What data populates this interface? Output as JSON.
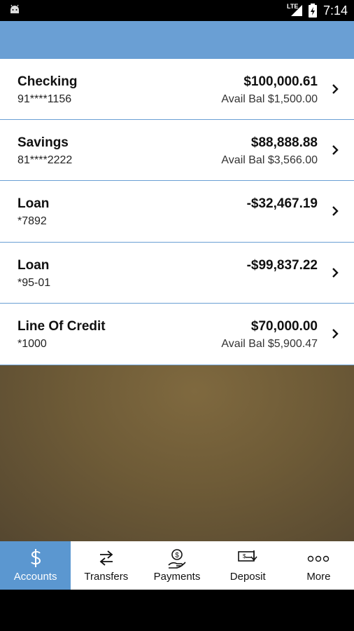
{
  "status_bar": {
    "network": "LTE",
    "time": "7:14"
  },
  "accounts": [
    {
      "name": "Checking",
      "number": "91****1156",
      "balance": "$100,000.61",
      "avail": "Avail Bal $1,500.00"
    },
    {
      "name": "Savings",
      "number": "81****2222",
      "balance": "$88,888.88",
      "avail": "Avail Bal $3,566.00"
    },
    {
      "name": "Loan",
      "number": "*7892",
      "balance": "-$32,467.19",
      "avail": ""
    },
    {
      "name": "Loan",
      "number": "*95-01",
      "balance": "-$99,837.22",
      "avail": ""
    },
    {
      "name": "Line Of Credit",
      "number": "*1000",
      "balance": "$70,000.00",
      "avail": "Avail Bal $5,900.47"
    }
  ],
  "tabs": [
    {
      "label": "Accounts",
      "icon": "dollar-icon",
      "active": true
    },
    {
      "label": "Transfers",
      "icon": "transfer-arrows-icon",
      "active": false
    },
    {
      "label": "Payments",
      "icon": "hand-coin-icon",
      "active": false
    },
    {
      "label": "Deposit",
      "icon": "check-deposit-icon",
      "active": false
    },
    {
      "label": "More",
      "icon": "more-dots-icon",
      "active": false
    }
  ],
  "colors": {
    "header_blue": "#6a9fd4",
    "active_tab": "#5b97d0",
    "brand_brown": "#6e5b37"
  }
}
